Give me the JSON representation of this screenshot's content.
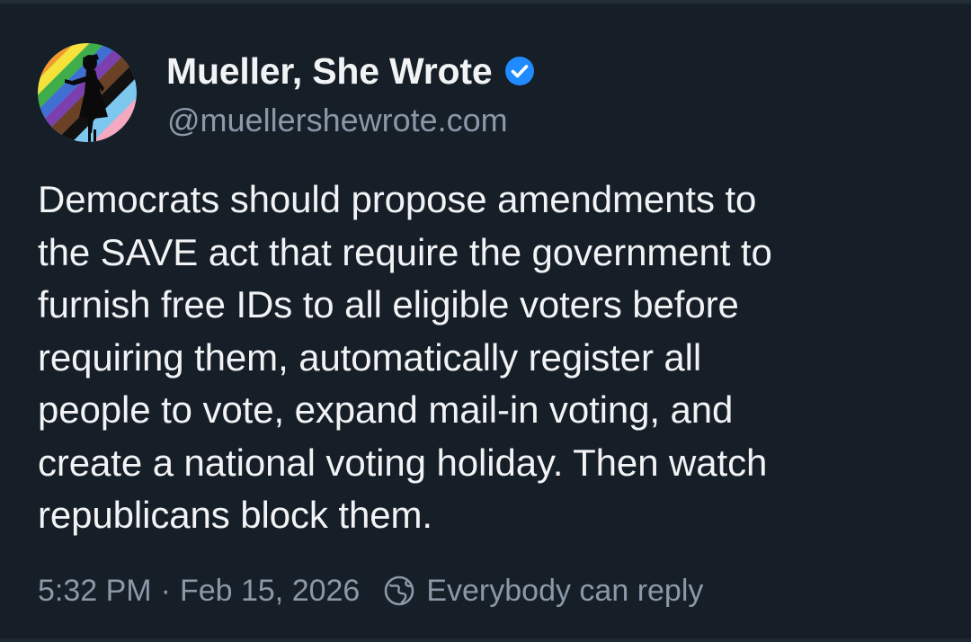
{
  "post": {
    "author": {
      "display_name": "Mueller, She Wrote",
      "handle": "@muellershewrote.com",
      "verified": true,
      "avatar_icon": "rainbow-silhouette-avatar"
    },
    "text_lines": [
      "Democrats should propose amendments to",
      "the SAVE act that require the government to",
      "furnish free IDs to all eligible voters before",
      "requiring them, automatically register all",
      "people to vote, expand mail-in voting, and",
      "create a national voting holiday. Then watch",
      "republicans block them."
    ],
    "time": "5:32 PM",
    "separator": "·",
    "date": "Feb 15, 2026",
    "reply_setting": "Everybody can reply",
    "reply_icon": "globe-icon"
  },
  "colors": {
    "background": "#161e27",
    "text_primary": "#f1f3f5",
    "text_secondary": "#8b98a7",
    "verified_badge": "#208bfe"
  }
}
